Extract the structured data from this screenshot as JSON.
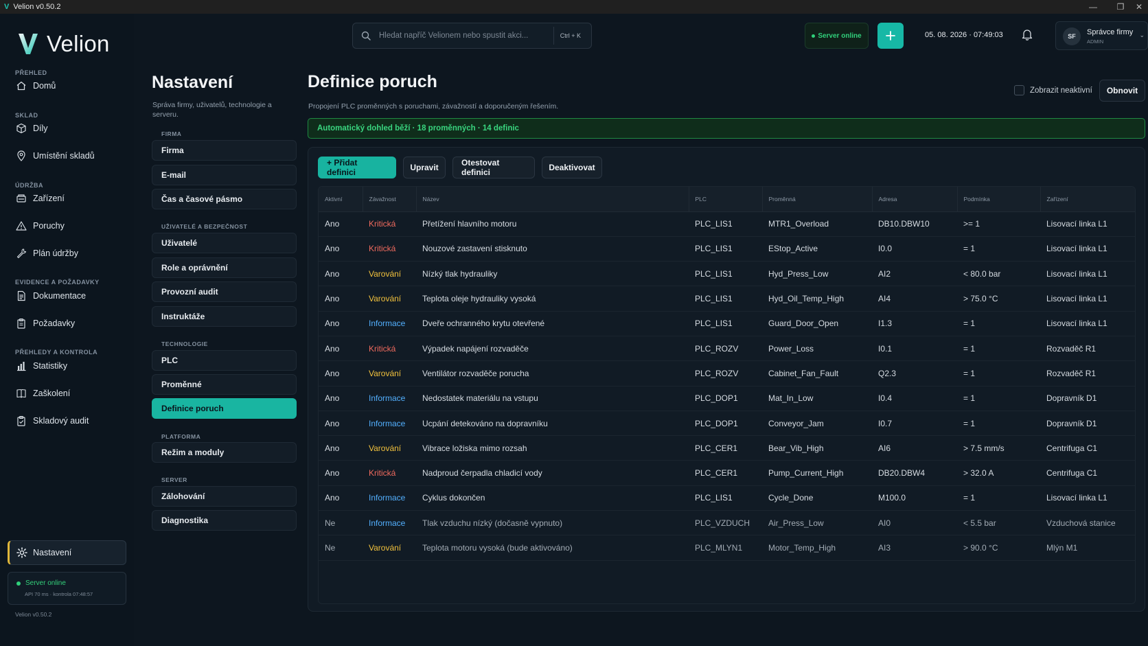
{
  "window": {
    "title": "Velion v0.50.2",
    "app_initial": "V"
  },
  "sidebar": {
    "brand": "Velion",
    "sections": [
      {
        "label": "PŘEHLED",
        "items": [
          {
            "label": "Domů",
            "icon": "home-icon"
          }
        ]
      },
      {
        "label": "SKLAD",
        "items": [
          {
            "label": "Díly",
            "icon": "box-icon"
          },
          {
            "label": "Umístění skladů",
            "icon": "map-pin-icon"
          }
        ]
      },
      {
        "label": "ÚDRŽBA",
        "items": [
          {
            "label": "Zařízení",
            "icon": "machine-icon"
          },
          {
            "label": "Poruchy",
            "icon": "warning-icon"
          },
          {
            "label": "Plán údržby",
            "icon": "wrench-icon"
          }
        ]
      },
      {
        "label": "EVIDENCE A POŽADAVKY",
        "items": [
          {
            "label": "Dokumentace",
            "icon": "document-icon"
          },
          {
            "label": "Požadavky",
            "icon": "clipboard-icon"
          }
        ]
      },
      {
        "label": "PŘEHLEDY A KONTROLA",
        "items": [
          {
            "label": "Statistiky",
            "icon": "chart-icon"
          },
          {
            "label": "Zaškolení",
            "icon": "book-icon"
          },
          {
            "label": "Skladový audit",
            "icon": "clipboard-check-icon"
          }
        ]
      }
    ],
    "active_item": "Nastavení",
    "status": {
      "label": "Server online",
      "detail": "API 70 ms · kontrola 07:48:57"
    },
    "version": "Velion v0.50.2"
  },
  "topbar": {
    "search_placeholder": "Hledat napříč Velionem nebo spustit akci...",
    "shortcut": "Ctrl + K",
    "server_status": "Server online",
    "datetime": "05. 08. 2026 · 07:49:03",
    "user": {
      "initials": "SF",
      "name": "Správce firmy",
      "role": "ADMIN"
    }
  },
  "settings_nav": {
    "title": "Nastavení",
    "subtitle": "Správa firmy, uživatelů, technologie a serveru.",
    "sections": [
      {
        "label": "FIRMA",
        "items": [
          "Firma",
          "E-mail",
          "Čas a časové pásmo"
        ]
      },
      {
        "label": "UŽIVATELÉ A BEZPEČNOST",
        "items": [
          "Uživatelé",
          "Role a oprávnění",
          "Provozní audit",
          "Instruktáže"
        ]
      },
      {
        "label": "TECHNOLOGIE",
        "items": [
          "PLC",
          "Proměnné",
          "Definice poruch"
        ]
      },
      {
        "label": "PLATFORMA",
        "items": [
          "Režim a moduly"
        ]
      },
      {
        "label": "SERVER",
        "items": [
          "Zálohování",
          "Diagnostika"
        ]
      }
    ],
    "active": "Definice poruch"
  },
  "main": {
    "title": "Definice poruch",
    "subtitle": "Propojení PLC proměnných s poruchami, závažností a doporučeným řešením.",
    "show_inactive_label": "Zobrazit neaktivní",
    "show_inactive_checked": false,
    "refresh_label": "Obnovit",
    "banner": "Automatický dohled běží · 18 proměnných · 14 definic",
    "actions": {
      "add": "+ Přidat definici",
      "edit": "Upravit",
      "test": "Otestovat definici",
      "deactivate": "Deaktivovat"
    },
    "columns": [
      "Aktivní",
      "Závažnost",
      "Název",
      "PLC",
      "Proměnná",
      "Adresa",
      "Podmínka",
      "Zařízení"
    ],
    "rows": [
      [
        "Ano",
        "Kritická",
        "Přetížení hlavního motoru",
        "PLC_LIS1",
        "MTR1_Overload",
        "DB10.DBW10",
        ">= 1",
        "Lisovací linka L1"
      ],
      [
        "Ano",
        "Kritická",
        "Nouzové zastavení stisknuto",
        "PLC_LIS1",
        "EStop_Active",
        "I0.0",
        "= 1",
        "Lisovací linka L1"
      ],
      [
        "Ano",
        "Varování",
        "Nízký tlak hydrauliky",
        "PLC_LIS1",
        "Hyd_Press_Low",
        "AI2",
        "< 80.0 bar",
        "Lisovací linka L1"
      ],
      [
        "Ano",
        "Varování",
        "Teplota oleje hydrauliky vysoká",
        "PLC_LIS1",
        "Hyd_Oil_Temp_High",
        "AI4",
        "> 75.0 °C",
        "Lisovací linka L1"
      ],
      [
        "Ano",
        "Informace",
        "Dveře ochranného krytu otevřené",
        "PLC_LIS1",
        "Guard_Door_Open",
        "I1.3",
        "= 1",
        "Lisovací linka L1"
      ],
      [
        "Ano",
        "Kritická",
        "Výpadek napájení rozvaděče",
        "PLC_ROZV",
        "Power_Loss",
        "I0.1",
        "= 1",
        "Rozvaděč R1"
      ],
      [
        "Ano",
        "Varování",
        "Ventilátor rozvaděče porucha",
        "PLC_ROZV",
        "Cabinet_Fan_Fault",
        "Q2.3",
        "= 1",
        "Rozvaděč R1"
      ],
      [
        "Ano",
        "Informace",
        "Nedostatek materiálu na vstupu",
        "PLC_DOP1",
        "Mat_In_Low",
        "I0.4",
        "= 1",
        "Dopravník D1"
      ],
      [
        "Ano",
        "Informace",
        "Ucpání detekováno na dopravníku",
        "PLC_DOP1",
        "Conveyor_Jam",
        "I0.7",
        "= 1",
        "Dopravník D1"
      ],
      [
        "Ano",
        "Varování",
        "Vibrace ložiska mimo rozsah",
        "PLC_CER1",
        "Bear_Vib_High",
        "AI6",
        "> 7.5 mm/s",
        "Centrifuga C1"
      ],
      [
        "Ano",
        "Kritická",
        "Nadproud čerpadla chladicí vody",
        "PLC_CER1",
        "Pump_Current_High",
        "DB20.DBW4",
        "> 32.0 A",
        "Centrifuga C1"
      ],
      [
        "Ano",
        "Informace",
        "Cyklus dokončen",
        "PLC_LIS1",
        "Cycle_Done",
        "M100.0",
        "= 1",
        "Lisovací linka L1"
      ],
      [
        "Ne",
        "Informace",
        "Tlak vzduchu nízký (dočasně vypnuto)",
        "PLC_VZDUCH",
        "Air_Press_Low",
        "AI0",
        "< 5.5 bar",
        "Vzduchová stanice"
      ],
      [
        "Ne",
        "Varování",
        "Teplota motoru vysoká (bude aktivováno)",
        "PLC_MLYN1",
        "Motor_Temp_High",
        "AI3",
        "> 90.0 °C",
        "Mlýn M1"
      ]
    ]
  },
  "colors": {
    "accent": "#18b3a0",
    "critical": "#f06a5e",
    "warning": "#f2c23d",
    "info": "#53b0ff",
    "online": "#31d07b",
    "active_marker": "#e0b73a"
  }
}
